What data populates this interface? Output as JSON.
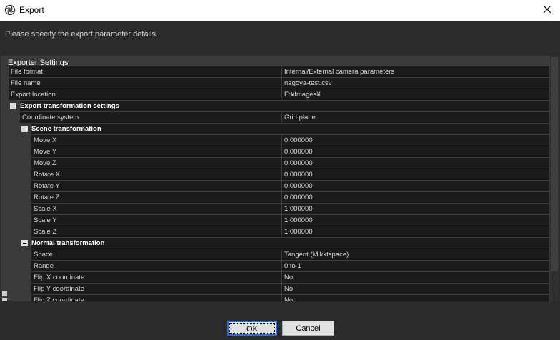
{
  "window": {
    "title": "Export",
    "app_icon": "swirl-logo-icon",
    "close_icon": "close-icon"
  },
  "instruction": "Please specify the export parameter details.",
  "grid": {
    "header": "Exporter Settings",
    "rows": [
      {
        "kind": "prop",
        "indent": 0,
        "label": "File format",
        "value": "Internal/External camera parameters"
      },
      {
        "kind": "prop",
        "indent": 0,
        "label": "File name",
        "value": "nagoya-test.csv"
      },
      {
        "kind": "prop",
        "indent": 0,
        "label": "Export location",
        "value": "E:¥Images¥"
      },
      {
        "kind": "cat",
        "indent": 0,
        "label": "Export transformation settings"
      },
      {
        "kind": "prop",
        "indent": 1,
        "label": "Coordinate system",
        "value": "Grid plane"
      },
      {
        "kind": "cat",
        "indent": 1,
        "label": "Scene transformation"
      },
      {
        "kind": "prop",
        "indent": 2,
        "label": "Move X",
        "value": "0.000000"
      },
      {
        "kind": "prop",
        "indent": 2,
        "label": "Move Y",
        "value": "0.000000"
      },
      {
        "kind": "prop",
        "indent": 2,
        "label": "Move Z",
        "value": "0.000000"
      },
      {
        "kind": "prop",
        "indent": 2,
        "label": "Rotate X",
        "value": "0.000000"
      },
      {
        "kind": "prop",
        "indent": 2,
        "label": "Rotate Y",
        "value": "0.000000"
      },
      {
        "kind": "prop",
        "indent": 2,
        "label": "Rotate Z",
        "value": "0.000000"
      },
      {
        "kind": "prop",
        "indent": 2,
        "label": "Scale X",
        "value": "1.000000"
      },
      {
        "kind": "prop",
        "indent": 2,
        "label": "Scale Y",
        "value": "1.000000"
      },
      {
        "kind": "prop",
        "indent": 2,
        "label": "Scale Z",
        "value": "1.000000"
      },
      {
        "kind": "cat",
        "indent": 1,
        "label": "Normal transformation"
      },
      {
        "kind": "prop",
        "indent": 2,
        "label": "Space",
        "value": "Tangent (Mikktspace)"
      },
      {
        "kind": "prop",
        "indent": 2,
        "label": "Range",
        "value": "0 to 1"
      },
      {
        "kind": "prop",
        "indent": 2,
        "label": "Flip X coordinate",
        "value": "No"
      },
      {
        "kind": "prop",
        "indent": 2,
        "label": "Flip Y coordinate",
        "value": "No"
      },
      {
        "kind": "prop",
        "indent": 2,
        "label": "Flip Z coordinate",
        "value": "No"
      }
    ]
  },
  "buttons": {
    "ok": "OK",
    "cancel": "Cancel"
  },
  "colors": {
    "background": "#2b2b2b",
    "grid_cell": "#1b1b1b",
    "grid_line": "#3a3a3a",
    "focus_border": "#2d6cd4"
  }
}
